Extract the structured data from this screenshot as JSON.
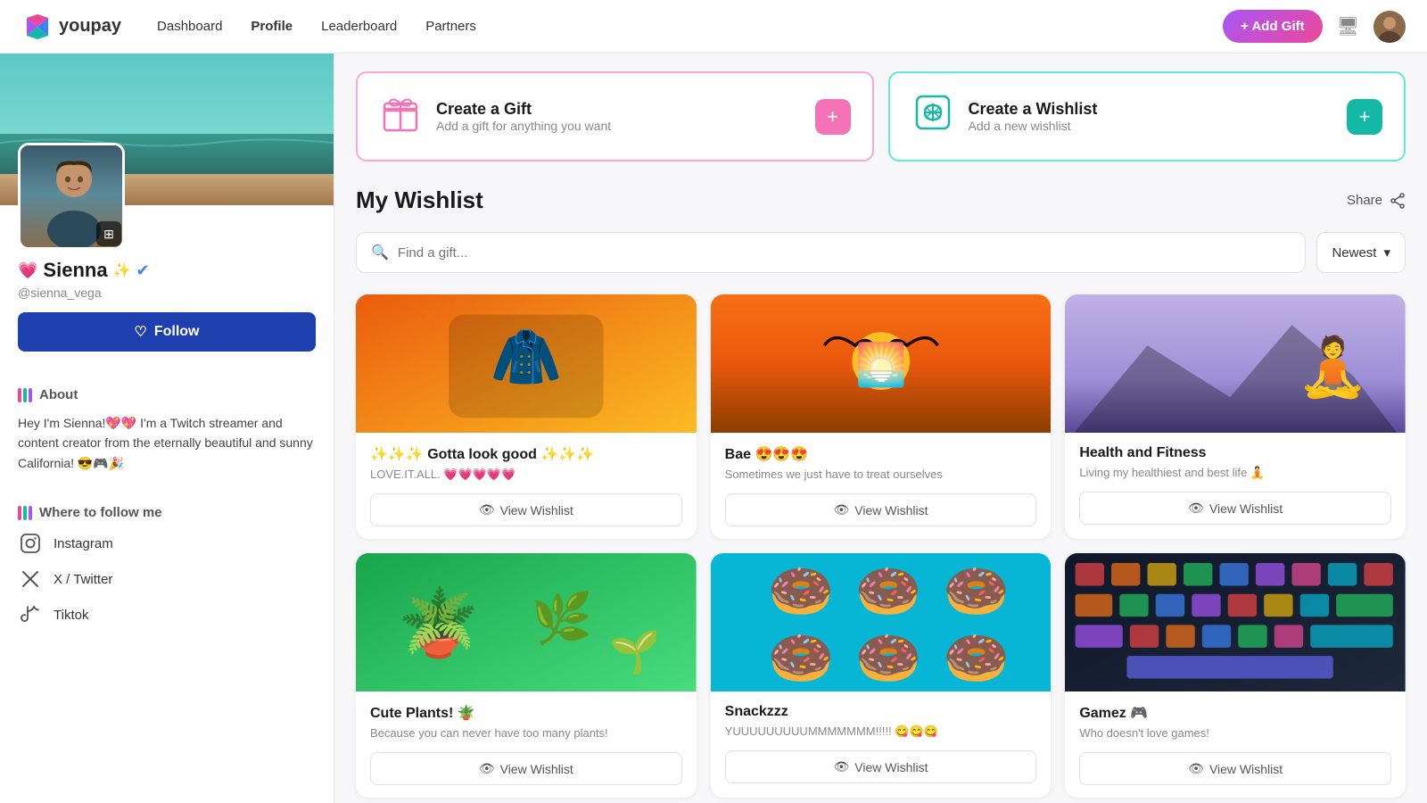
{
  "nav": {
    "logo_text": "youpay",
    "links": [
      "Dashboard",
      "Profile",
      "Leaderboard",
      "Partners"
    ],
    "active_link": "Profile",
    "add_gift_label": "+ Add Gift",
    "user_avatar_emoji": "👩"
  },
  "sidebar": {
    "user": {
      "name": "Sienna",
      "username": "@sienna_vega",
      "verified": true,
      "heart_emoji": "💗",
      "sparkle_emoji": "✨",
      "follow_label": "Follow"
    },
    "about": {
      "title": "About",
      "text": "Hey I'm Sienna!💖💖 I'm a Twitch streamer and content creator from the eternally beautiful and sunny California! 😎🎮🎉"
    },
    "social": {
      "title": "Where to follow me",
      "platforms": [
        {
          "name": "Instagram",
          "icon": "instagram"
        },
        {
          "name": "X / Twitter",
          "icon": "twitter"
        },
        {
          "name": "Tiktok",
          "icon": "tiktok"
        }
      ]
    }
  },
  "main": {
    "action_cards": [
      {
        "title": "Create a Gift",
        "subtitle": "Add a gift for anything you want",
        "type": "gift"
      },
      {
        "title": "Create a Wishlist",
        "subtitle": "Add a new wishlist",
        "type": "wishlist"
      }
    ],
    "wishlist_title": "My Wishlist",
    "share_label": "Share",
    "search_placeholder": "Find a gift...",
    "sort_label": "Newest",
    "wishlists": [
      {
        "name": "✨✨✨ Gotta look good ✨✨✨",
        "desc": "LOVE.IT.ALL. 💗💗💗💗💗",
        "view_label": "View Wishlist",
        "bg": "orange",
        "emoji": "🧥"
      },
      {
        "name": "Bae 😍😍😍",
        "desc": "Sometimes we just have to treat ourselves",
        "view_label": "View Wishlist",
        "bg": "sunset",
        "emoji": "🌅"
      },
      {
        "name": "Health and Fitness",
        "desc": "Living my healthiest and best life 🧘",
        "view_label": "View Wishlist",
        "bg": "purple",
        "emoji": "🧘"
      },
      {
        "name": "Cute Plants! 🪴",
        "desc": "Because you can never have too many plants!",
        "view_label": "View Wishlist",
        "bg": "green",
        "emoji": "🪴"
      },
      {
        "name": "Snackzzz",
        "desc": "YUUUUUUUUUMMMMMMM!!!!! 😋😋😋",
        "view_label": "View Wishlist",
        "bg": "donut",
        "emoji": "🍩"
      },
      {
        "name": "Gamez 🎮",
        "desc": "Who doesn't love games!",
        "view_label": "View Wishlist",
        "bg": "keyboard",
        "emoji": "🎮"
      }
    ]
  }
}
